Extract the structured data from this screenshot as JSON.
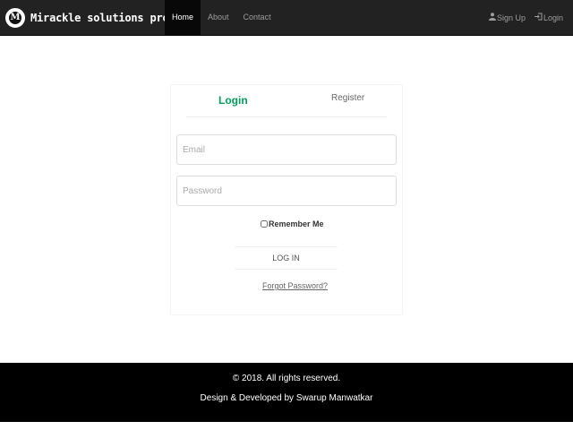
{
  "navbar": {
    "brand": "Mirackle solutions project",
    "logo_icon": "m-logo-icon",
    "links": [
      {
        "label": "Home",
        "active": true
      },
      {
        "label": "About",
        "active": false
      },
      {
        "label": "Contact",
        "active": false
      }
    ],
    "right": {
      "signup_label": "Sign Up",
      "signup_icon": "user-icon",
      "login_label": "Login",
      "login_icon": "login-icon"
    }
  },
  "login_form": {
    "tabs": {
      "login": "Login",
      "register": "Register"
    },
    "email_placeholder": "Email",
    "password_placeholder": "Password",
    "remember_label": "Remember Me",
    "submit_label": "LOG IN",
    "forgot_label": "Forgot Password?"
  },
  "footer": {
    "copyright": "© 2018. All rights reserved.",
    "credit": "Design & Developed by Swarup Manwatkar"
  },
  "colors": {
    "navbar_bg": "#222222",
    "active_tab": "#029f5b",
    "footer_bg": "#000000"
  }
}
